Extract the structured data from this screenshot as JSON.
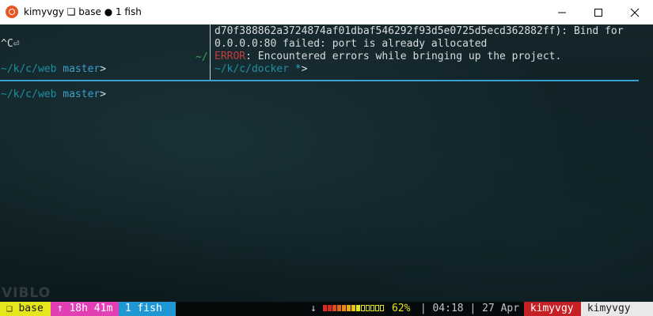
{
  "window": {
    "title": "kimyvgy ❑ base ● 1 fish",
    "buttons": {
      "minimize": "minimize",
      "maximize": "maximize",
      "close": "close"
    }
  },
  "left_pane": {
    "interrupt": "^C⏎",
    "right_marker": "~/",
    "prompt_path": "~/k/c/web",
    "prompt_branch": "master",
    "prompt_symbol": ">"
  },
  "right_pane": {
    "line1": "d70f388862a3724874af01dbaf546292f93d5e0725d5ecd362882ff): Bind for",
    "line2": "0.0.0.0:80 failed: port is already allocated",
    "error_label": "ERROR",
    "error_message": ": Encountered errors while bringing up the project.",
    "prompt_path": "~/k/c/docker",
    "prompt_branch": "*",
    "prompt_symbol": ">"
  },
  "bottom_pane": {
    "prompt_path": "~/k/c/web",
    "prompt_branch": "master",
    "prompt_symbol": ">"
  },
  "watermark": "VIBLO",
  "statusbar": {
    "session": "❑ base",
    "uptime": "↑ 18h 41m",
    "window": "1 fish",
    "battery_arrow": "↓",
    "battery_percent": "62%",
    "sep": "|",
    "time": "04:18",
    "date": "27 Apr",
    "user": "kimyvgy",
    "host": "kimyvgy"
  },
  "colors": {
    "accent_blue": "#3a9fd0",
    "error_red": "#c63b3b",
    "path_teal": "#1f8fa3",
    "branch_blue": "#3c9ec9"
  }
}
